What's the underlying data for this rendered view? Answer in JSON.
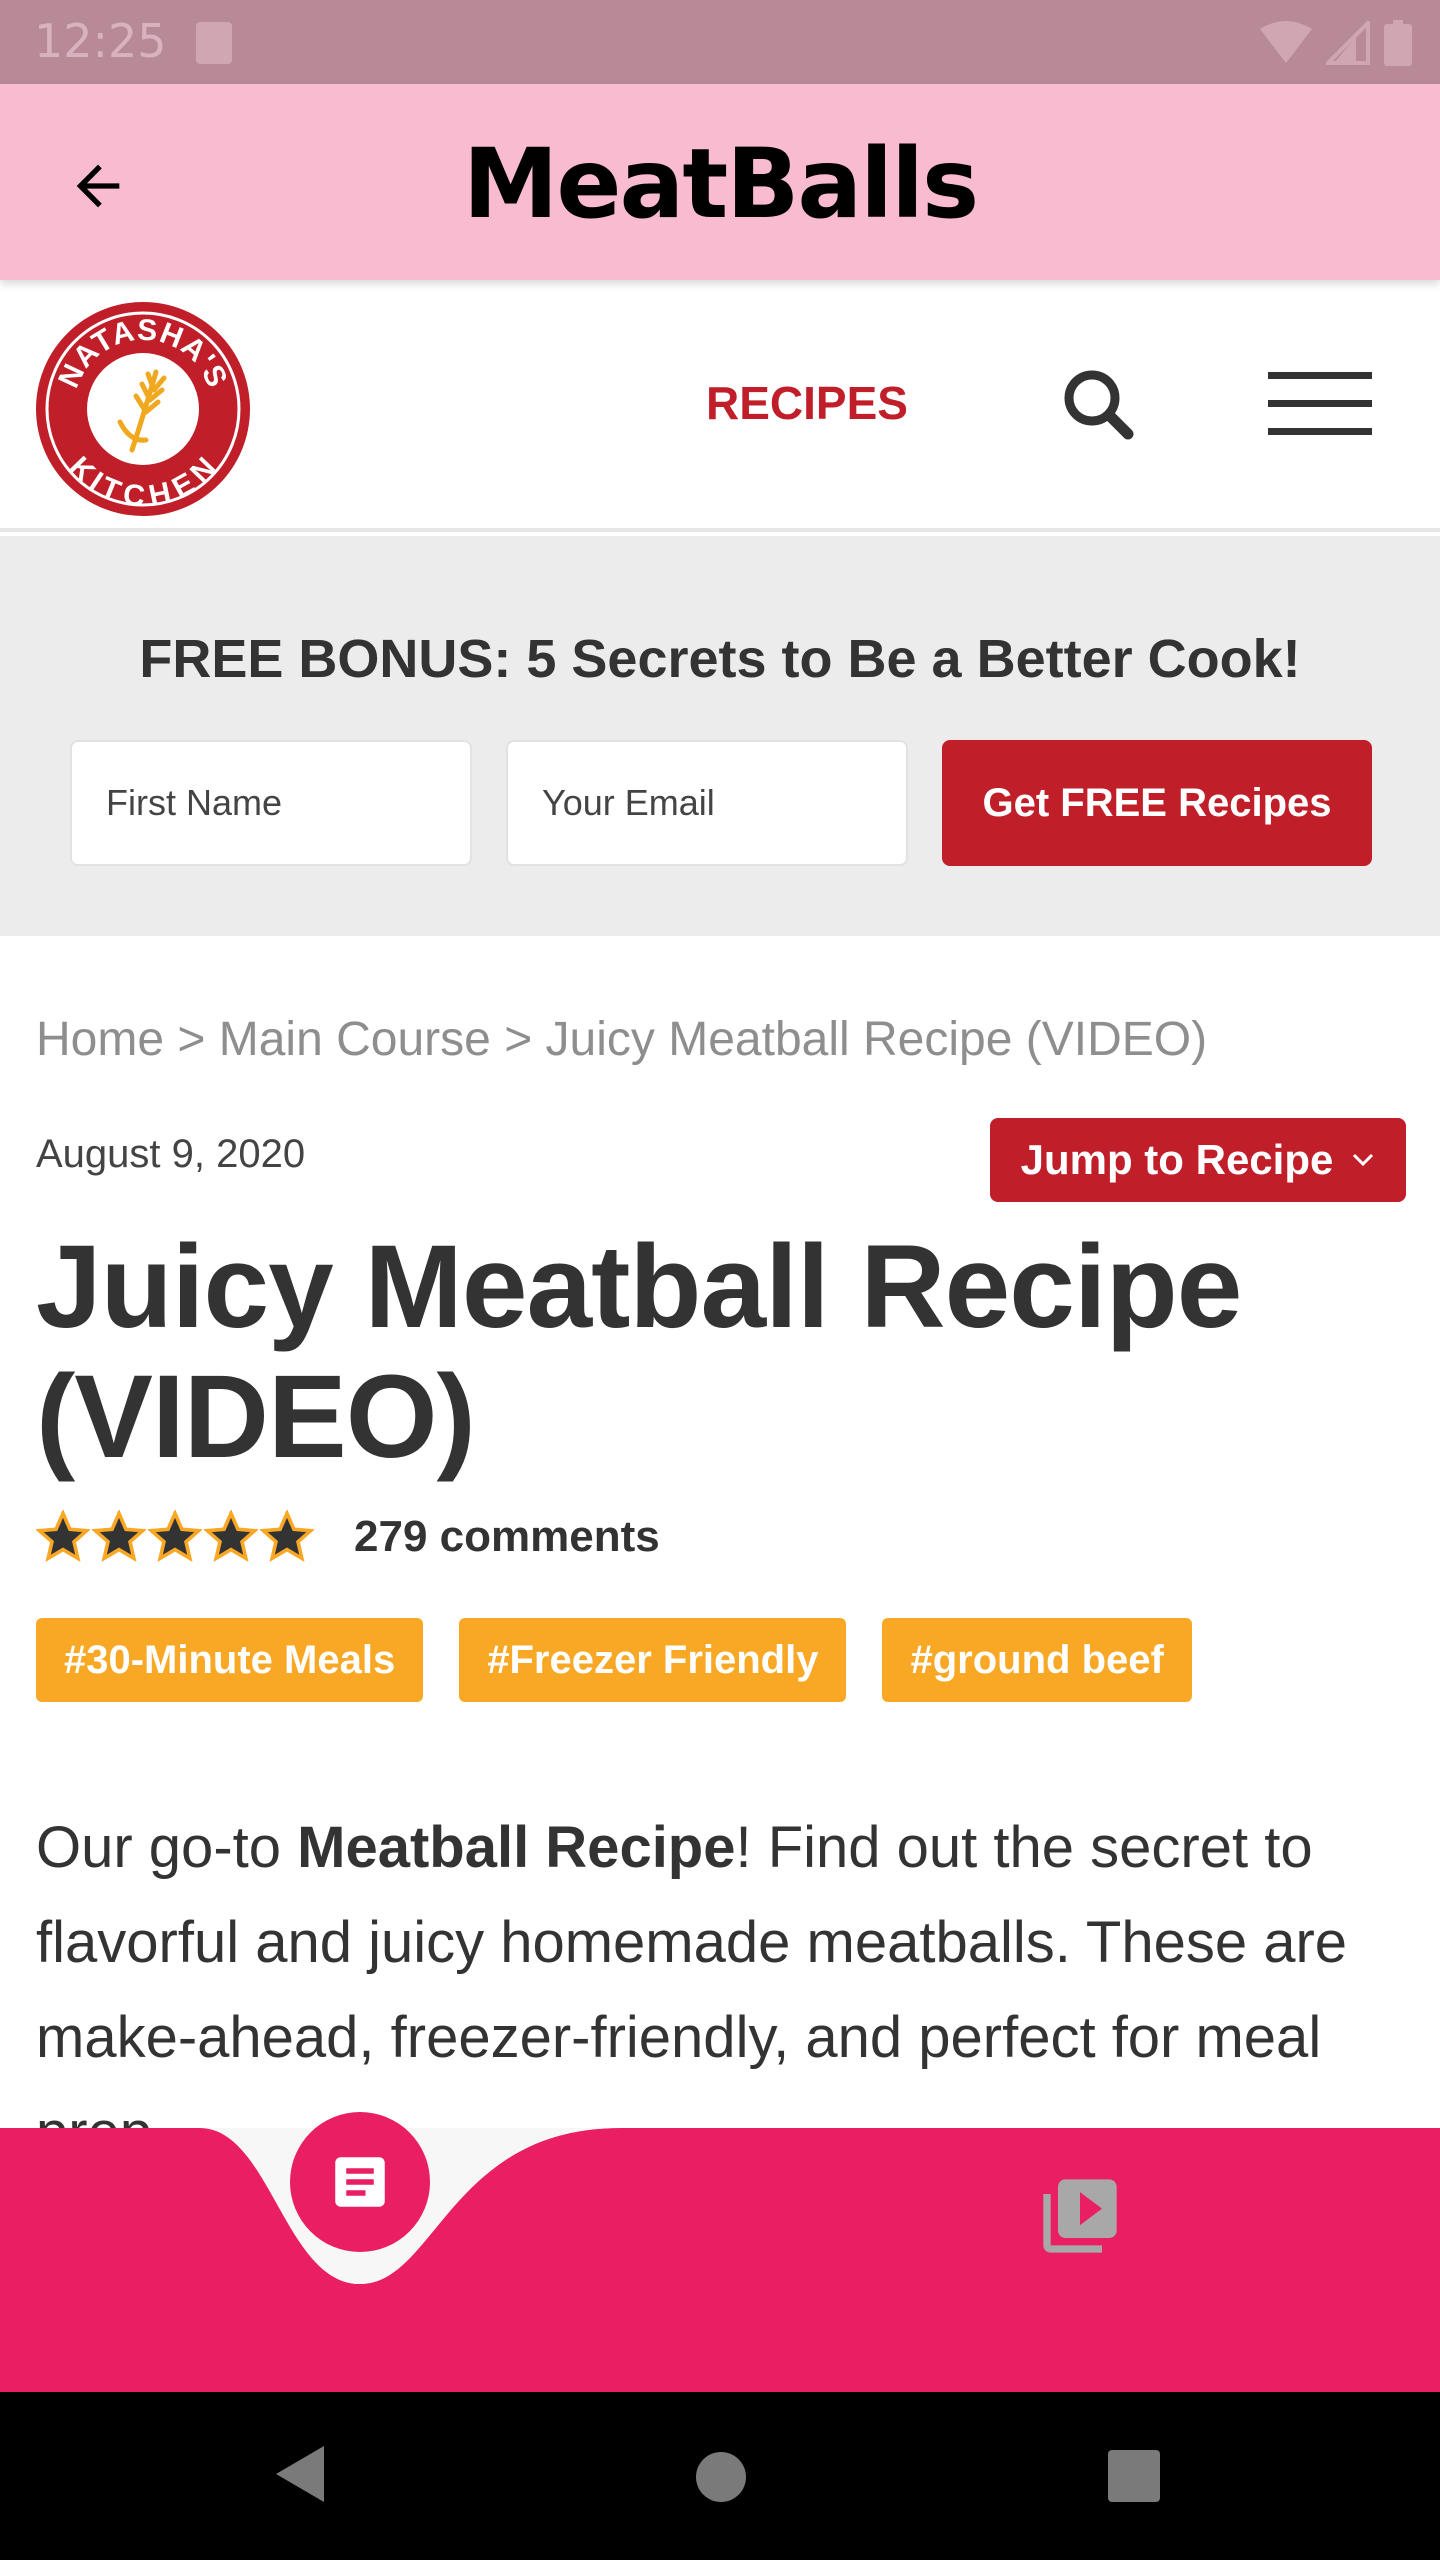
{
  "status_bar": {
    "time": "12:25"
  },
  "app_bar": {
    "title": "MeatBalls"
  },
  "site_header": {
    "logo_text": "NATASHA'S KITCHEN",
    "nav_recipes": "RECIPES",
    "brand_color": "#c01f2a"
  },
  "bonus": {
    "title": "FREE BONUS: 5 Secrets to Be a Better Cook!",
    "first_name_placeholder": "First Name",
    "email_placeholder": "Your Email",
    "button_label": "Get FREE Recipes"
  },
  "article": {
    "breadcrumb": "Home > Main Course > Juicy Meatball Recipe (VIDEO)",
    "date": "August 9, 2020",
    "jump_label": "Jump to Recipe",
    "title": "Juicy Meatball Recipe (VIDEO)",
    "rating_stars": 5,
    "comments": "279 comments",
    "tags": [
      "#30-Minute Meals",
      "#Freezer Friendly",
      "#ground beef"
    ],
    "intro_before": "Our go-to ",
    "intro_bold": "Meatball Recipe",
    "intro_after": "! Find out the secret to flavorful and juicy homemade meatballs. These are make-ahead, freezer-friendly, and perfect for meal prep."
  },
  "colors": {
    "app_bar": "#f8bbd0",
    "bottom_nav": "#e91e63",
    "tag": "#f9a825"
  },
  "bottom_nav": {
    "items": [
      {
        "icon": "article-icon",
        "active": true
      },
      {
        "icon": "video-library-icon",
        "active": false
      }
    ]
  }
}
